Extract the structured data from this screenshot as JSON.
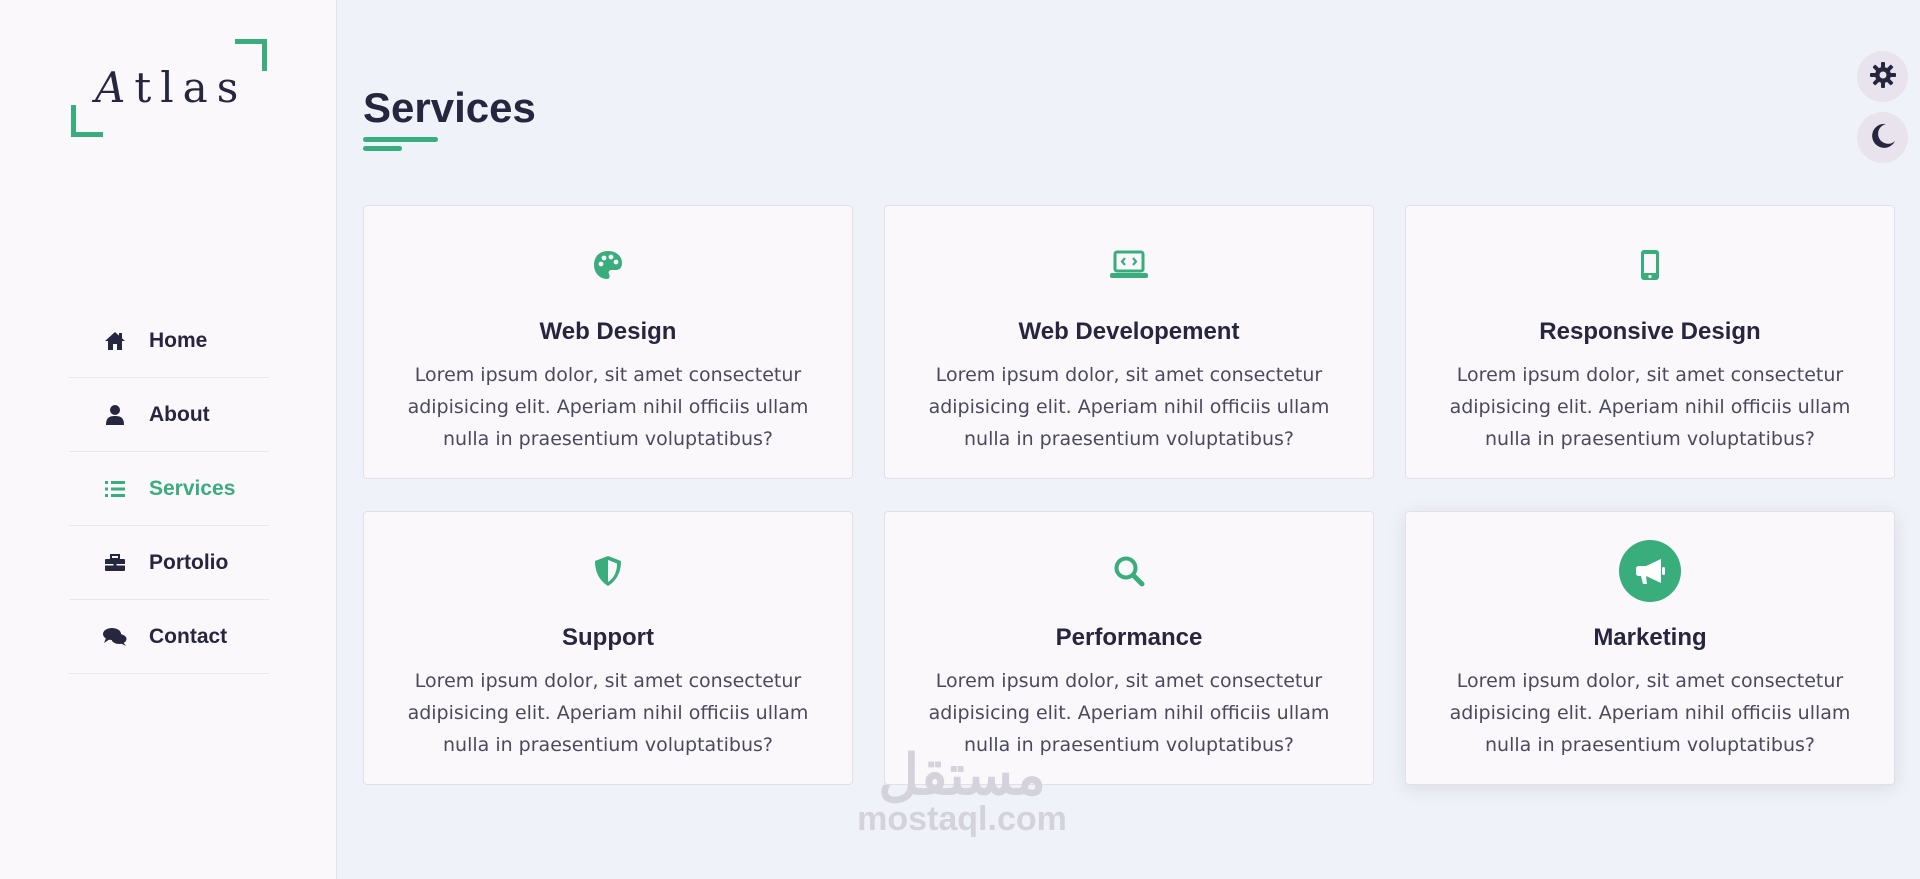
{
  "brand": {
    "logo_text_first": "A",
    "logo_text_rest": "tlas"
  },
  "sidebar": {
    "items": [
      {
        "label": "Home",
        "icon": "home-icon",
        "active": false
      },
      {
        "label": "About",
        "icon": "user-icon",
        "active": false
      },
      {
        "label": "Services",
        "icon": "list-icon",
        "active": true
      },
      {
        "label": "Portolio",
        "icon": "briefcase-icon",
        "active": false
      },
      {
        "label": "Contact",
        "icon": "chat-icon",
        "active": false
      }
    ]
  },
  "main": {
    "title": "Services",
    "cards": [
      {
        "title": "Web Design",
        "icon": "palette-icon",
        "text": "Lorem ipsum dolor, sit amet consectetur adipisicing elit. Aperiam nihil officiis ullam nulla in praesentium voluptatibus?"
      },
      {
        "title": "Web Developement",
        "icon": "laptop-code-icon",
        "text": "Lorem ipsum dolor, sit amet consectetur adipisicing elit. Aperiam nihil officiis ullam nulla in praesentium voluptatibus?"
      },
      {
        "title": "Responsive Design",
        "icon": "mobile-icon",
        "text": "Lorem ipsum dolor, sit amet consectetur adipisicing elit. Aperiam nihil officiis ullam nulla in praesentium voluptatibus?"
      },
      {
        "title": "Support",
        "icon": "shield-icon",
        "text": "Lorem ipsum dolor, sit amet consectetur adipisicing elit. Aperiam nihil officiis ullam nulla in praesentium voluptatibus?"
      },
      {
        "title": "Performance",
        "icon": "search-icon",
        "text": "Lorem ipsum dolor, sit amet consectetur adipisicing elit. Aperiam nihil officiis ullam nulla in praesentium voluptatibus?"
      },
      {
        "title": "Marketing",
        "icon": "megaphone-icon",
        "text": "Lorem ipsum dolor, sit amet consectetur adipisicing elit. Aperiam nihil officiis ullam nulla in praesentium voluptatibus?"
      }
    ]
  },
  "controls": {
    "settings_icon": "gear-icon",
    "theme_icon": "moon-icon"
  },
  "watermark": {
    "arabic": "مستقل",
    "latin": "mostaql.com"
  },
  "colors": {
    "accent": "#3aad7d",
    "text_dark": "#27263f",
    "background": "#f0f2f9",
    "card_bg": "#fbf8fc"
  }
}
